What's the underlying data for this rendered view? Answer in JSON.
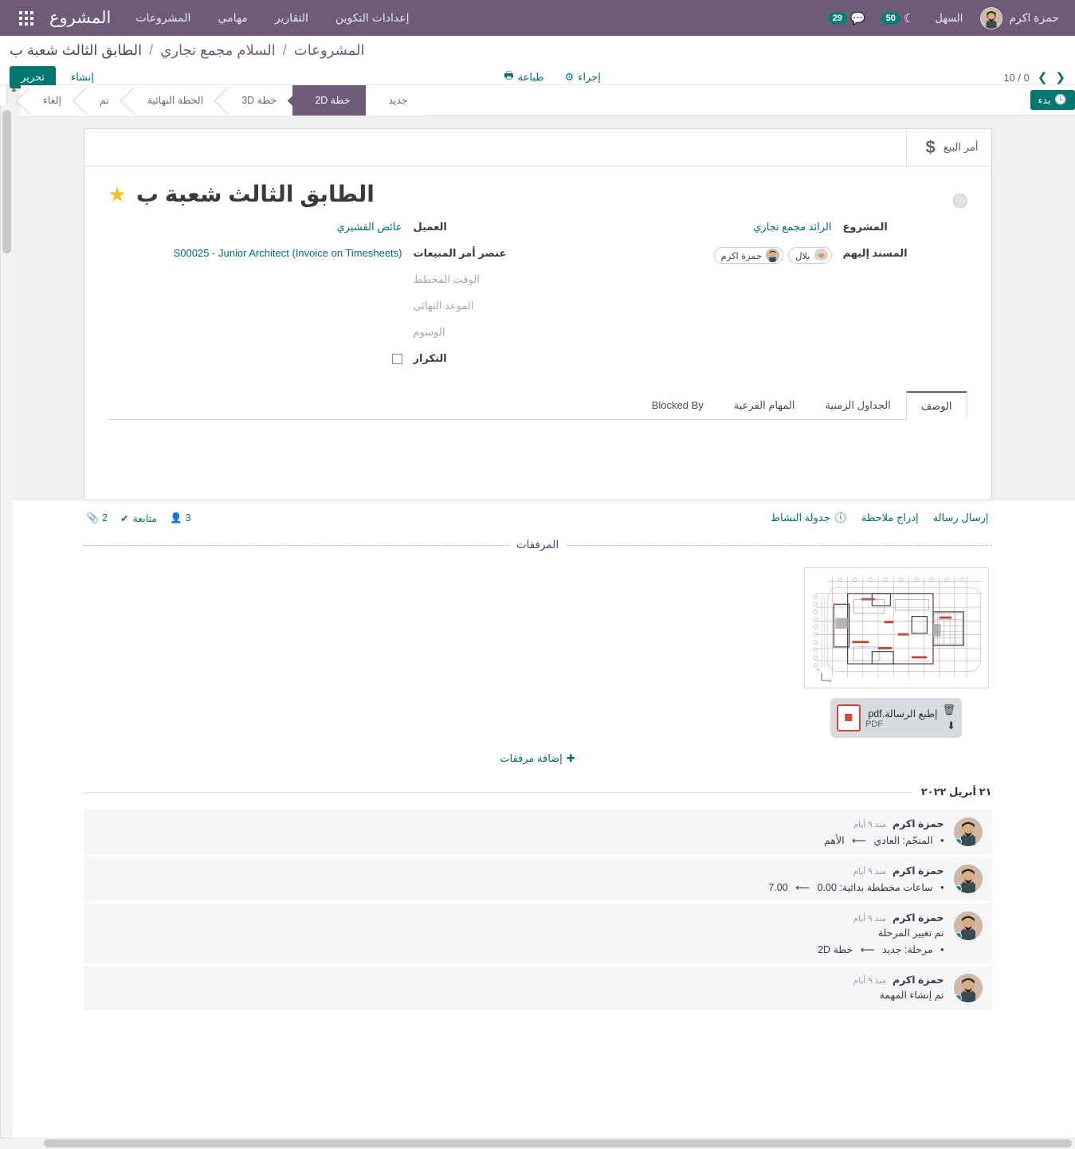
{
  "navbar": {
    "apps_icon": "apps-grid-icon",
    "brand": "المشروع",
    "menu": [
      {
        "label": "المشروعات",
        "name": "nav-projects"
      },
      {
        "label": "مهامي",
        "name": "nav-my-tasks"
      },
      {
        "label": "التقارير",
        "name": "nav-reports"
      },
      {
        "label": "إعدادات التكوين",
        "name": "nav-configuration"
      }
    ],
    "activity_count": "50",
    "messages_count": "29",
    "sandbox_label": "السهل",
    "user_name": "حمزة اكرم"
  },
  "control_panel": {
    "breadcrumb": {
      "root": "المشروعات",
      "parent": "السلام مجمع تجاري",
      "current": "الطابق الثالث شعبة ب",
      "separator": "/"
    },
    "edit_label": "تحرير",
    "create_label": "إنشاء",
    "print_label": "طباعة",
    "action_label": "إجراء",
    "pager": "10 / 0"
  },
  "statusbar": {
    "stages": [
      {
        "label": "جديد",
        "active": false
      },
      {
        "label": "خطة 2D",
        "active": true
      },
      {
        "label": "خطة 3D",
        "active": false
      },
      {
        "label": "الخطة النهائية",
        "active": false
      },
      {
        "label": "تم",
        "active": false
      },
      {
        "label": "إلغاء",
        "active": false
      }
    ],
    "start_button": "بدء"
  },
  "sheet": {
    "stat_buttons": [
      {
        "label": "أمر البيع",
        "icon": "dollar-icon"
      }
    ],
    "title": "الطابق الثالث شعبة ب",
    "starred": true,
    "fields_right": [
      {
        "label": "المشروع",
        "value": "الرائد مجمع تجاري",
        "type": "link"
      },
      {
        "label": "المسند إليهم",
        "value": "",
        "type": "tags"
      }
    ],
    "assignees": [
      {
        "name": "بلال"
      },
      {
        "name": "حمزة اكرم"
      }
    ],
    "fields_left": [
      {
        "label": "العميل",
        "value": "عائض القشيري",
        "type": "link"
      },
      {
        "label": "عنصر أمر المبيعات",
        "value": "S00025 - Junior Architect (Invoice on Timesheets)",
        "type": "link-ltr"
      },
      {
        "label": "الوقت المخطط",
        "value": "",
        "type": "empty"
      },
      {
        "label": "الموعد النهائي",
        "value": "",
        "type": "empty"
      },
      {
        "label": "الوسوم",
        "value": "",
        "type": "empty"
      },
      {
        "label": "التكرار",
        "value": "",
        "type": "checkbox",
        "checked": false
      }
    ],
    "notebook_tabs": [
      {
        "label": "الوصف",
        "active": true
      },
      {
        "label": "الجداول الزمنية",
        "active": false
      },
      {
        "label": "المهام الفرعية",
        "active": false
      },
      {
        "label": "Blocked By",
        "active": false
      }
    ],
    "description_content": ""
  },
  "chatter": {
    "send_message": "إرسال رسالة",
    "log_note": "إدراج ملاحظة",
    "schedule_activity": "جدولة النشاط",
    "followers_count": "3",
    "following_label": "متابعة",
    "attachments_count": "2",
    "attachments_title": "المرفقات",
    "add_attachments": "إضافة مرفقات",
    "attachment": {
      "name": "إطبع الرسالة.pdf",
      "type": "PDF",
      "delete_icon": "trash-icon",
      "download_icon": "download-icon",
      "thumbnail": "architectural-floor-plan"
    },
    "date_separator": "٢١ أبريل ٢٠٢٢",
    "messages": [
      {
        "author": "حمزة اكرم",
        "date": "منذ ٩ أيام",
        "body": "",
        "tracking": [
          {
            "field": "المنجّم",
            "old": "العادي",
            "new": "الأهم"
          }
        ]
      },
      {
        "author": "حمزة اكرم",
        "date": "منذ ٩ أيام",
        "body": "",
        "tracking": [
          {
            "field": "ساعات مخططة بدائية",
            "old": "0.00",
            "new": "7.00"
          }
        ]
      },
      {
        "author": "حمزة اكرم",
        "date": "منذ ٩ أيام",
        "body": "تم تغيير المرحلة",
        "tracking": [
          {
            "field": "مرحلة",
            "old": "جديد",
            "new": "خطة 2D"
          }
        ]
      },
      {
        "author": "حمزة اكرم",
        "date": "منذ ٩ أيام",
        "body": "تم إنشاء المهمة",
        "tracking": []
      }
    ]
  },
  "colors": {
    "navbar": "#6d5b78",
    "accent_teal": "#00786f",
    "stage_active": "#6d5b78",
    "star": "#f0c419",
    "pdf_red": "#cf4b41"
  }
}
